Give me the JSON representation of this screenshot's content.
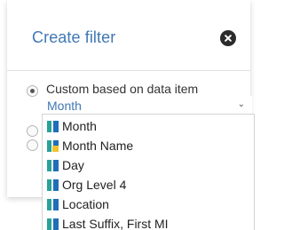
{
  "dialog": {
    "title": "Create filter",
    "close_icon": "close-circle-icon"
  },
  "filter_type": {
    "custom_label": "Custom based on data item",
    "selected_item": "Month"
  },
  "dropdown": {
    "options": [
      {
        "label": "Month",
        "icon": "measure-column-icon"
      },
      {
        "label": "Month Name",
        "icon": "calculated-column-icon"
      },
      {
        "label": "Day",
        "icon": "measure-column-icon"
      },
      {
        "label": "Org Level 4",
        "icon": "measure-column-icon"
      },
      {
        "label": "Location",
        "icon": "measure-column-icon"
      },
      {
        "label": "Last Suffix, First MI",
        "icon": "measure-column-icon"
      }
    ]
  },
  "colors": {
    "accent": "#3f78b5",
    "icon_blue": "#1f6fb8",
    "icon_teal": "#2aa198",
    "icon_yellow": "#f2c230"
  }
}
